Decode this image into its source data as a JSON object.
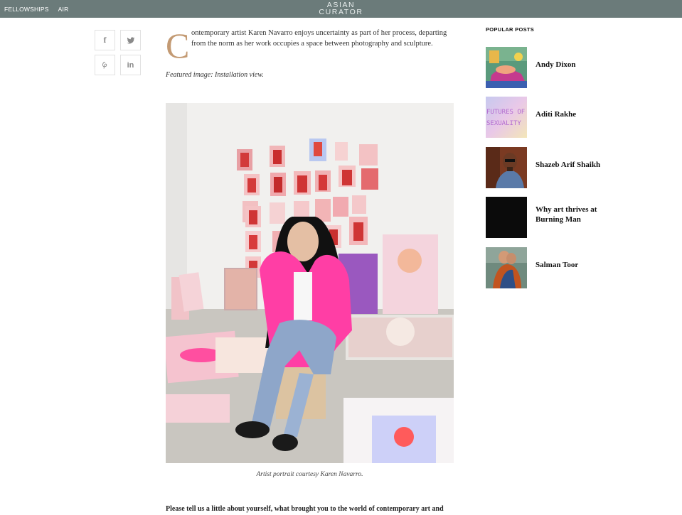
{
  "nav": {
    "items": [
      "FELLOWSHIPS",
      "AIR"
    ],
    "logo_line1": "ASIAN",
    "logo_line2": "CURATOR"
  },
  "share": {
    "facebook": "f",
    "twitter": "twitter-icon",
    "pinterest": "pinterest-icon",
    "linkedin": "in"
  },
  "article": {
    "dropcap": "C",
    "lead": "ontemporary artist Karen Navarro enjoys uncertainty as part of her process, departing from the norm as her work occupies a space between photography and sculpture.",
    "featured": "Featured image: Installation view.",
    "caption": "Artist portrait courtesy Karen Navarro.",
    "question": "Please tell us a little about yourself, what brought you to the world of contemporary art and how"
  },
  "sidebar": {
    "title": "POPULAR POSTS",
    "posts": [
      {
        "title": "Andy Dixon"
      },
      {
        "title": "Aditi Rakhe",
        "thumb_text_1": "FUTURES OF",
        "thumb_text_2": "SEXUALITY"
      },
      {
        "title": "Shazeb Arif Shaikh"
      },
      {
        "title": "Why art thrives at Burning Man"
      },
      {
        "title": "Salman Toor"
      }
    ]
  },
  "colors": {
    "topbar": "#6b7b7a",
    "accent_dropcap": "#c39a73",
    "blazer_pink": "#ff3ea5"
  }
}
